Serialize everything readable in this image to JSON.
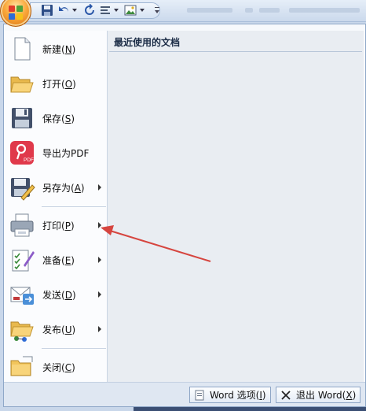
{
  "menu": {
    "recent_title": "最近使用的文档",
    "items": [
      {
        "label": "新建(",
        "key": "N",
        "tail": ")",
        "icon": "new-document-icon",
        "submenu": false
      },
      {
        "label": "打开(",
        "key": "O",
        "tail": ")",
        "icon": "open-folder-icon",
        "submenu": false
      },
      {
        "label": "保存(",
        "key": "S",
        "tail": ")",
        "icon": "save-floppy-icon",
        "submenu": false
      },
      {
        "label": "导出为PDF",
        "key": "",
        "tail": "",
        "icon": "pdf-export-icon",
        "submenu": false
      },
      {
        "label": "另存为(",
        "key": "A",
        "tail": ")",
        "icon": "save-as-icon",
        "submenu": true
      },
      {
        "label": "打印(",
        "key": "P",
        "tail": ")",
        "icon": "printer-icon",
        "submenu": true
      },
      {
        "label": "准备(",
        "key": "E",
        "tail": ")",
        "icon": "prepare-icon",
        "submenu": true
      },
      {
        "label": "发送(",
        "key": "D",
        "tail": ")",
        "icon": "send-icon",
        "submenu": true
      },
      {
        "label": "发布(",
        "key": "U",
        "tail": ")",
        "icon": "publish-icon",
        "submenu": true
      },
      {
        "label": "关闭(",
        "key": "C",
        "tail": ")",
        "icon": "close-folder-icon",
        "submenu": false
      }
    ]
  },
  "bottom": {
    "options_label": "Word 选项(",
    "options_key": "I",
    "options_tail": ")",
    "exit_label": "退出 Word(",
    "exit_key": "X",
    "exit_tail": ")"
  },
  "colors": {
    "annotation_arrow": "#d6453f",
    "office_button": "#f9a83b",
    "pdf_icon": "#e0394b"
  }
}
